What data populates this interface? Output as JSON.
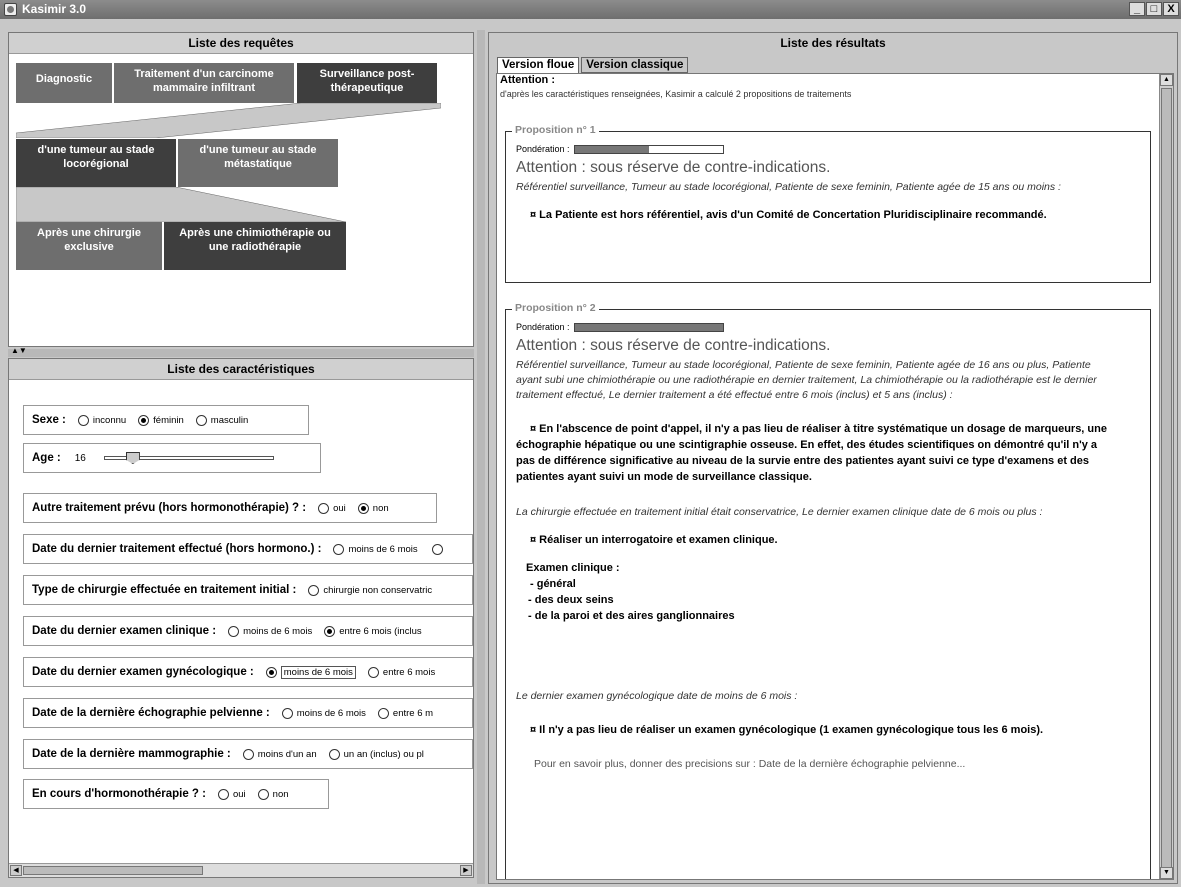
{
  "window": {
    "title": "Kasimir 3.0",
    "controls": [
      "_",
      "̲θ",
      "X"
    ]
  },
  "requests": {
    "title": "Liste des requêtes",
    "level1": [
      "Diagnostic",
      "Traitement d'un carcinome mammaire infiltrant",
      "Surveillance post-thérapeutique"
    ],
    "level2": [
      "d'une tumeur au stade locorégional",
      "d'une tumeur au stade métastatique"
    ],
    "level3": [
      "Après une chirurgie exclusive",
      "Après une chimiothérapie ou une radiothérapie"
    ]
  },
  "chars": {
    "title": "Liste des caractéristiques",
    "sexe": {
      "label": "Sexe :",
      "options": [
        "inconnu",
        "féminin",
        "masculin"
      ]
    },
    "age": {
      "label": "Age :",
      "value": "16"
    },
    "autre": {
      "label": "Autre traitement prévu (hors hormonothérapie) ? :",
      "options": [
        "oui",
        "non"
      ]
    },
    "date_trait": {
      "label": "Date du dernier traitement effectué (hors hormono.) :",
      "options": [
        "moins de 6 mois"
      ]
    },
    "type_chir": {
      "label": "Type de chirurgie effectuée en traitement initial :",
      "options": [
        "chirurgie non conservatric"
      ]
    },
    "date_clin": {
      "label": "Date du dernier examen clinique :",
      "options": [
        "moins de 6 mois",
        "entre 6 mois (inclus"
      ]
    },
    "date_gyn": {
      "label": "Date du dernier examen gynécologique :",
      "options": [
        "moins de 6 mois",
        "entre 6 mois"
      ]
    },
    "date_echo": {
      "label": "Date de la dernière échographie pelvienne :",
      "options": [
        "moins de 6 mois",
        "entre 6 m"
      ]
    },
    "date_mammo": {
      "label": "Date de la dernière mammographie :",
      "options": [
        "moins d'un an",
        "un an (inclus) ou pl"
      ]
    },
    "hormono": {
      "label": "En cours d'hormonothérapie ? :",
      "options": [
        "oui",
        "non"
      ]
    }
  },
  "results": {
    "title": "Liste des résultats",
    "tabs": [
      "Version floue",
      "Version classique"
    ],
    "attention": "Attention :",
    "intro": "d'après les caractéristiques renseignées, Kasimir a calculé 2 propositions de traitements",
    "p1": {
      "legend": "Proposition n° 1",
      "pond_label": "Pondération :",
      "weight": 0.5,
      "warning": "Attention : sous réserve de contre-indications.",
      "context": "Référentiel surveillance, Tumeur au stade locorégional, Patiente de sexe feminin, Patiente agée de 15 ans ou moins :",
      "rec": "¤ La Patiente est hors référentiel, avis d'un Comité de Concertation Pluridisciplinaire recommandé."
    },
    "p2": {
      "legend": "Proposition n° 2",
      "pond_label": "Pondération :",
      "weight": 1.0,
      "warning": "Attention : sous réserve de contre-indications.",
      "context": "Référentiel surveillance, Tumeur au stade locorégional, Patiente de sexe feminin, Patiente agée de 16 ans ou plus, Patiente ayant subi une chimiothérapie ou une radiothérapie en dernier traitement, La chimiothérapie ou la radiothérapie est le dernier traitement effectué, Le dernier traitement a été effectué entre 6 mois (inclus) et 5 ans (inclus) :",
      "rec1": "¤ En l'abscence de point d'appel, il n'y a pas lieu de réaliser à titre systématique un dosage de marqueurs, une échographie hépatique ou une scintigraphie osseuse. En effet, des études scientifiques on démontré qu'il n'y a pas de différence significative au niveau de la survie entre des patientes ayant suivi ce type d'examens et des patientes ayant suivi un mode de surveillance classique.",
      "context2": "La chirurgie effectuée en traitement initial était conservatrice, Le dernier examen clinique date de 6 mois ou plus :",
      "rec2": "¤ Réaliser un interrogatoire et examen clinique.",
      "exam_title": "Examen clinique :",
      "exam_items": [
        "- général",
        "- des deux seins",
        "- de la paroi et des aires ganglionnaires"
      ],
      "context3": "Le dernier examen gynécologique date de moins de 6 mois :",
      "rec3": "¤ Il n'y a pas lieu de réaliser un examen gynécologique (1 examen gynécologique tous les 6 mois).",
      "more": "Pour en savoir plus, donner des precisions sur : Date de la dernière échographie pelvienne..."
    }
  }
}
